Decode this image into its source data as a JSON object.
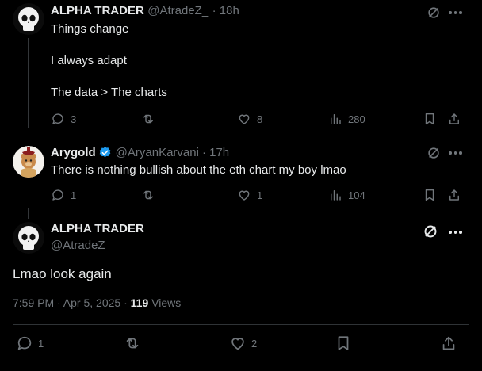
{
  "post1": {
    "display_name": "ALPHA TRADER",
    "handle": "@AtradeZ_",
    "time": "· 18h",
    "lines": [
      "Things change",
      "I always adapt",
      "The data > The charts"
    ],
    "replies": "3",
    "reposts": "",
    "likes": "8",
    "views": "280"
  },
  "post2": {
    "display_name": "Arygold",
    "handle": "@AryanKarvani",
    "time": "· 17h",
    "text": "There is nothing bullish about the eth chart my boy lmao",
    "replies": "1",
    "reposts": "",
    "likes": "1",
    "views": "104"
  },
  "main": {
    "display_name": "ALPHA TRADER",
    "handle": "@AtradeZ_",
    "text": "Lmao look again",
    "timestamp": "7:59 PM · Apr 5, 2025 · ",
    "views_count": "119",
    "views_label": " Views",
    "replies": "1",
    "likes": "2"
  },
  "colors": {
    "background": "#000000",
    "verified": "#1d9bf0",
    "muted": "#71767b",
    "text": "#e7e9ea"
  },
  "icons": [
    "reply-icon",
    "repost-icon",
    "like-icon",
    "views-icon",
    "bookmark-icon",
    "share-icon",
    "grok-icon",
    "more-icon",
    "verified-badge-icon"
  ]
}
